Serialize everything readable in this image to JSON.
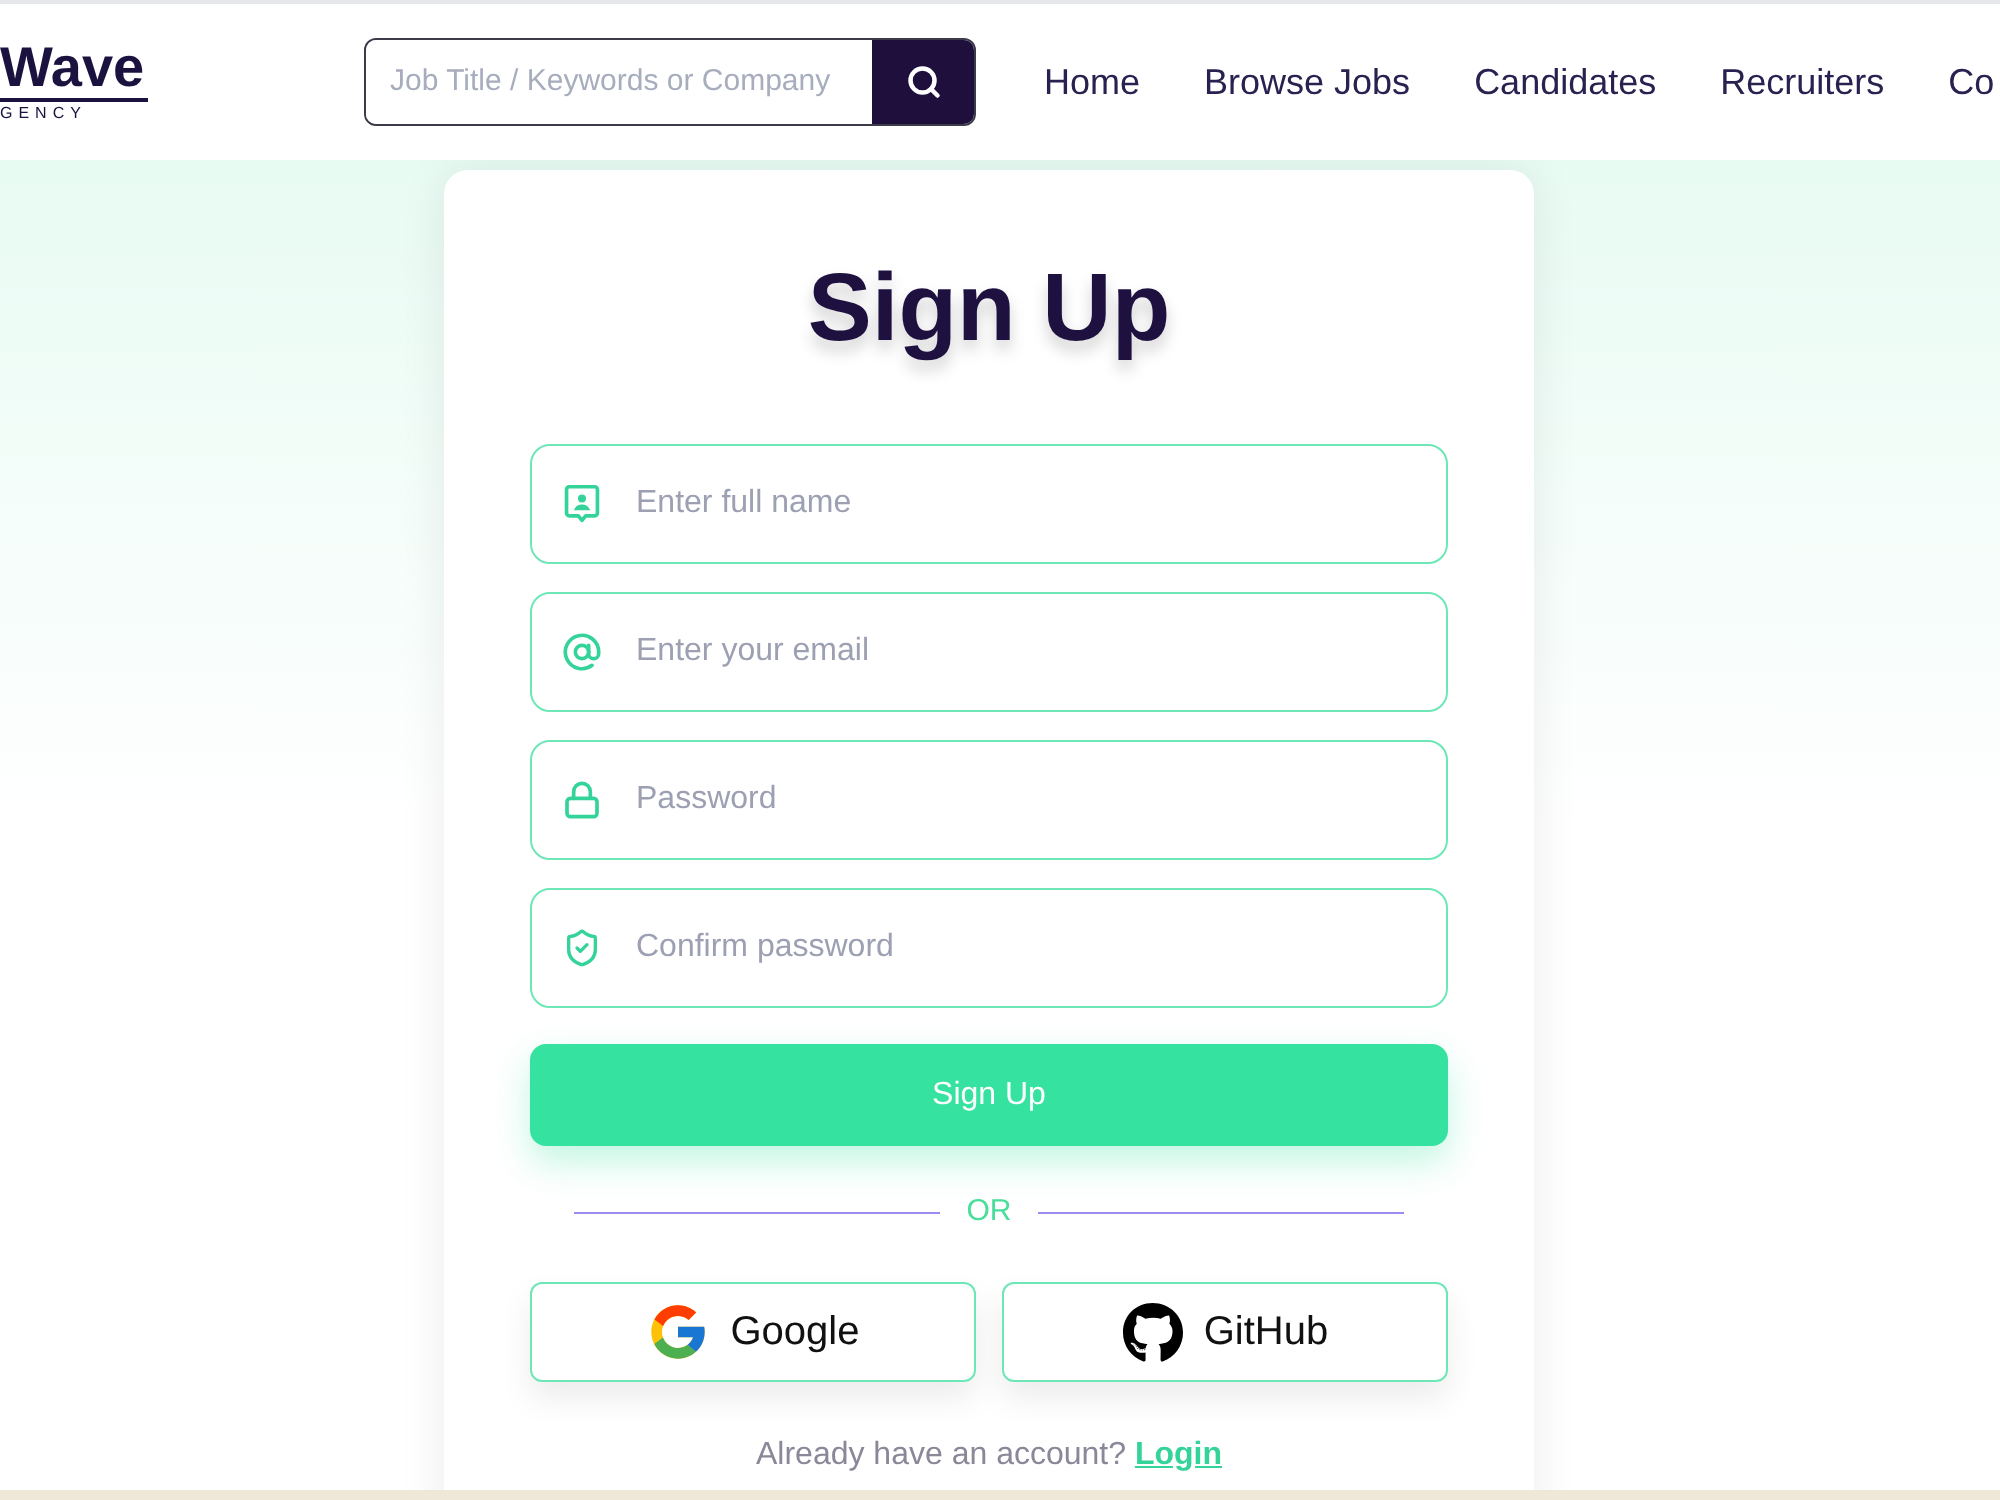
{
  "header": {
    "logo": {
      "name": "Wave",
      "tagline": "GENCY"
    },
    "search": {
      "placeholder": "Job Title / Keywords or Company"
    },
    "nav": [
      {
        "label": "Home"
      },
      {
        "label": "Browse Jobs"
      },
      {
        "label": "Candidates"
      },
      {
        "label": "Recruiters"
      },
      {
        "label": "Co"
      }
    ]
  },
  "form": {
    "title": "Sign Up",
    "fields": [
      {
        "kind": "name",
        "placeholder": "Enter full name"
      },
      {
        "kind": "email",
        "placeholder": "Enter your email"
      },
      {
        "kind": "password",
        "placeholder": "Password"
      },
      {
        "kind": "confirm",
        "placeholder": "Confirm password"
      }
    ],
    "submit": "Sign Up",
    "divider": "OR",
    "social": [
      {
        "kind": "google",
        "label": "Google"
      },
      {
        "kind": "github",
        "label": "GitHub"
      }
    ],
    "footer": {
      "text": "Already have an account?",
      "link": "Login"
    }
  }
}
